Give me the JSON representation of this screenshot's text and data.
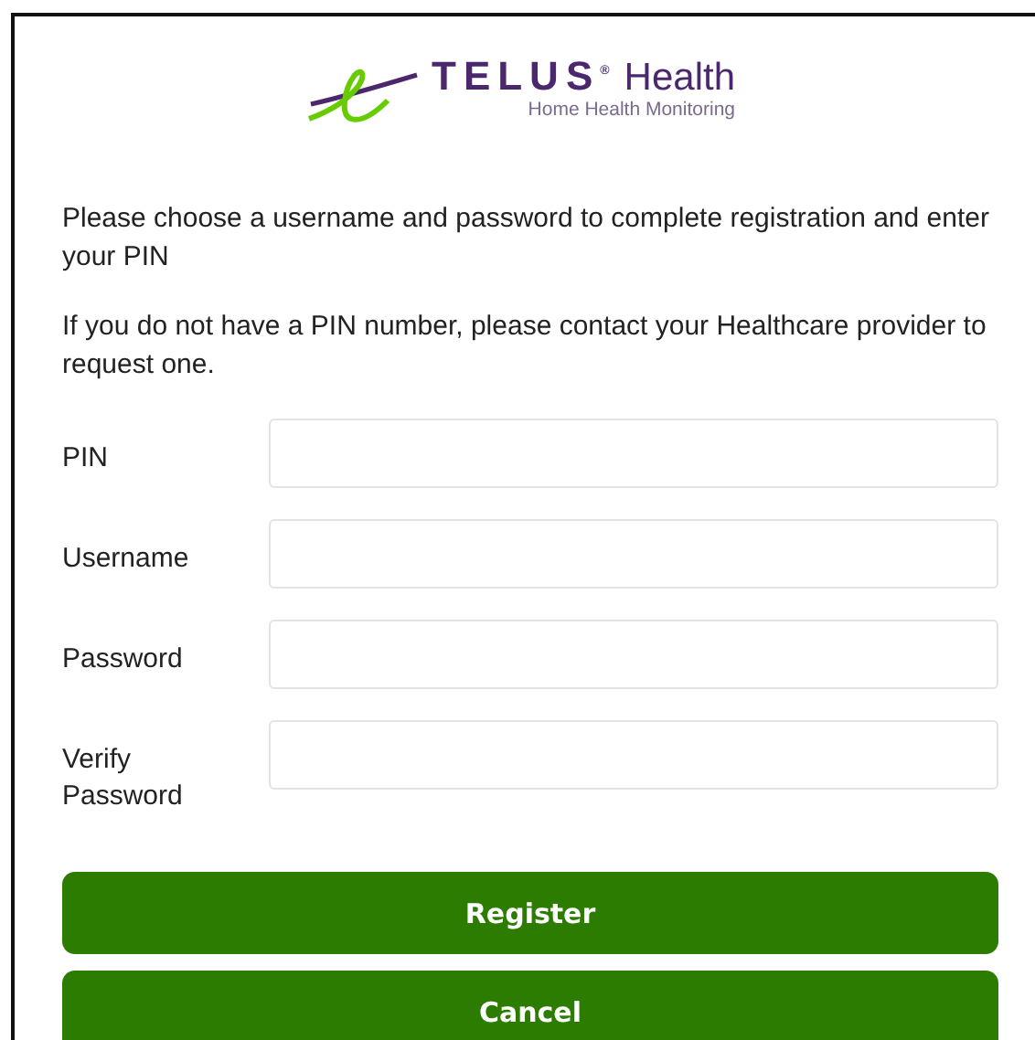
{
  "logo": {
    "brand": "TELUS$^{®}$",
    "product": "Health",
    "tagline": "Home Health Monitoring"
  },
  "intro": [
    "Please choose a username and password to complete registration and enter your PIN",
    "If you do not have a PIN number, please contact your Healthcare provider to request one."
  ],
  "fields": [
    {
      "label": "PIN"
    },
    {
      "label": "Username"
    },
    {
      "label": "Password"
    },
    {
      "label": "Verify Password"
    }
  ],
  "buttons": [
    "Register",
    "Cancel"
  ]
}
